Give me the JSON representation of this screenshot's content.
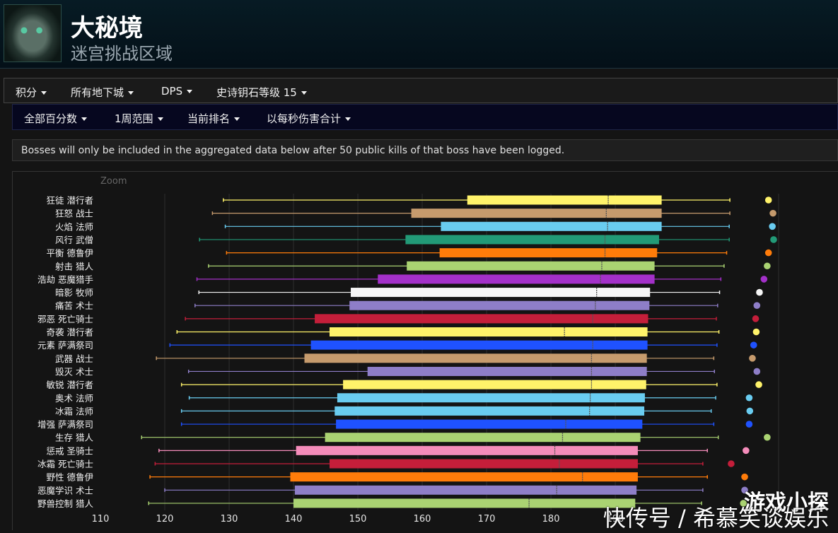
{
  "header": {
    "title": "大秘境",
    "subtitle": "迷宫挑战区域"
  },
  "toolbar": {
    "items": [
      "积分",
      "所有地下城",
      "DPS",
      "史诗钥石等级 15"
    ]
  },
  "subbar": {
    "items": [
      "全部百分数",
      "1周范围",
      "当前排名",
      "以每秒伤害合计"
    ]
  },
  "notice": "Bosses will only be included in the aggregated data below after 50 public kills of that boss have been logged.",
  "zoom_label": "Zoom",
  "watermark": {
    "line1": "游戏小探",
    "line2": "快传号 / 希慕笑谈娱乐"
  },
  "chart_data": {
    "type": "boxplot",
    "orientation": "horizontal",
    "x_ticks": [
      110,
      120,
      130,
      140,
      150,
      160,
      170,
      180,
      190
    ],
    "xlim": [
      110,
      199
    ],
    "grid": true,
    "categories": [
      "狂徒 潜行者",
      "狂怒 战士",
      "火焰 法师",
      "风行 武僧",
      "平衡 德鲁伊",
      "射击 猎人",
      "浩劫 恶魔猎手",
      "暗影 牧师",
      "痛苦 术士",
      "邪恶 死亡骑士",
      "奇袭 潜行者",
      "元素 萨满祭司",
      "武器 战士",
      "毁灭 术士",
      "敏锐 潜行者",
      "奥术 法师",
      "冰霜 法师",
      "增强 萨满祭司",
      "生存 猎人",
      "惩戒 圣骑士",
      "冰霜 死亡骑士",
      "野性 德鲁伊",
      "恶魔学识 术士",
      "野兽控制 猎人"
    ],
    "series": [
      {
        "min": 129.1,
        "q1": 167.0,
        "median": 188.9,
        "q3": 197.2,
        "max": 207.8,
        "point": 213.8,
        "color": "#fff36a"
      },
      {
        "min": 127.4,
        "q1": 158.3,
        "median": 188.6,
        "q3": 197.2,
        "max": 207.8,
        "point": 214.5,
        "color": "#c69b6d"
      },
      {
        "min": 129.4,
        "q1": 162.9,
        "median": 188.8,
        "q3": 197.2,
        "max": 207.7,
        "point": 214.4,
        "color": "#69ccf0"
      },
      {
        "min": 125.4,
        "q1": 157.4,
        "median": 188.4,
        "q3": 196.8,
        "max": 207.7,
        "point": 214.6,
        "color": "#229a77"
      },
      {
        "min": 129.6,
        "q1": 162.7,
        "median": 188.4,
        "q3": 196.5,
        "max": 207.3,
        "point": 213.8,
        "color": "#ff7c0a"
      },
      {
        "min": 126.8,
        "q1": 157.6,
        "median": 187.9,
        "q3": 196.1,
        "max": 206.9,
        "point": 213.6,
        "color": "#aad372"
      },
      {
        "min": 125.0,
        "q1": 153.1,
        "median": 187.7,
        "q3": 196.1,
        "max": 206.4,
        "point": 213.1,
        "color": "#a330c9"
      },
      {
        "min": 125.3,
        "q1": 148.9,
        "median": 187.1,
        "q3": 195.4,
        "max": 206.2,
        "point": 212.4,
        "color": "#f5f5f5"
      },
      {
        "min": 124.7,
        "q1": 148.7,
        "median": 186.9,
        "q3": 195.3,
        "max": 205.9,
        "point": 212.0,
        "color": "#8e7ec8"
      },
      {
        "min": 123.2,
        "q1": 143.3,
        "median": 186.5,
        "q3": 195.1,
        "max": 205.7,
        "point": 211.8,
        "color": "#c41e3a"
      },
      {
        "min": 121.9,
        "q1": 145.6,
        "median": 182.1,
        "q3": 195.0,
        "max": 206.1,
        "point": 211.9,
        "color": "#fff36a"
      },
      {
        "min": 120.8,
        "q1": 142.7,
        "median": 186.5,
        "q3": 195.0,
        "max": 205.8,
        "point": 211.5,
        "color": "#1f52ff"
      },
      {
        "min": 118.7,
        "q1": 141.7,
        "median": 186.3,
        "q3": 194.9,
        "max": 205.3,
        "point": 211.3,
        "color": "#c69b6d"
      },
      {
        "min": 123.7,
        "q1": 151.5,
        "median": 186.3,
        "q3": 194.9,
        "max": 205.4,
        "point": 212.0,
        "color": "#8e7ec8"
      },
      {
        "min": 122.6,
        "q1": 147.7,
        "median": 186.3,
        "q3": 194.8,
        "max": 205.8,
        "point": 212.3,
        "color": "#fff36a"
      },
      {
        "min": 123.8,
        "q1": 146.8,
        "median": 186.1,
        "q3": 194.6,
        "max": 205.6,
        "point": 210.8,
        "color": "#69ccf0"
      },
      {
        "min": 122.6,
        "q1": 146.4,
        "median": 186.0,
        "q3": 194.5,
        "max": 204.9,
        "point": 210.9,
        "color": "#69ccf0"
      },
      {
        "min": 122.6,
        "q1": 146.6,
        "median": 182.3,
        "q3": 194.2,
        "max": 205.3,
        "point": 210.8,
        "color": "#1f52ff"
      },
      {
        "min": 116.4,
        "q1": 144.9,
        "median": 181.8,
        "q3": 193.9,
        "max": 206.0,
        "point": 213.6,
        "color": "#aad372"
      },
      {
        "min": 119.1,
        "q1": 140.4,
        "median": 180.6,
        "q3": 193.5,
        "max": 204.3,
        "point": 210.3,
        "color": "#f48cba"
      },
      {
        "min": 118.5,
        "q1": 145.6,
        "median": 181.3,
        "q3": 193.5,
        "max": 203.6,
        "point": 208.0,
        "color": "#c41e3a"
      },
      {
        "min": 117.7,
        "q1": 139.5,
        "median": 184.9,
        "q3": 193.5,
        "max": 204.3,
        "point": 210.1,
        "color": "#ff7c0a"
      },
      {
        "min": 120.0,
        "q1": 140.2,
        "median": 180.9,
        "q3": 193.3,
        "max": 203.6,
        "point": 210.1,
        "color": "#8e7ec8"
      },
      {
        "min": 117.5,
        "q1": 140.0,
        "median": 176.6,
        "q3": 193.1,
        "max": 203.4,
        "point": 209.9,
        "color": "#aad372"
      }
    ]
  }
}
